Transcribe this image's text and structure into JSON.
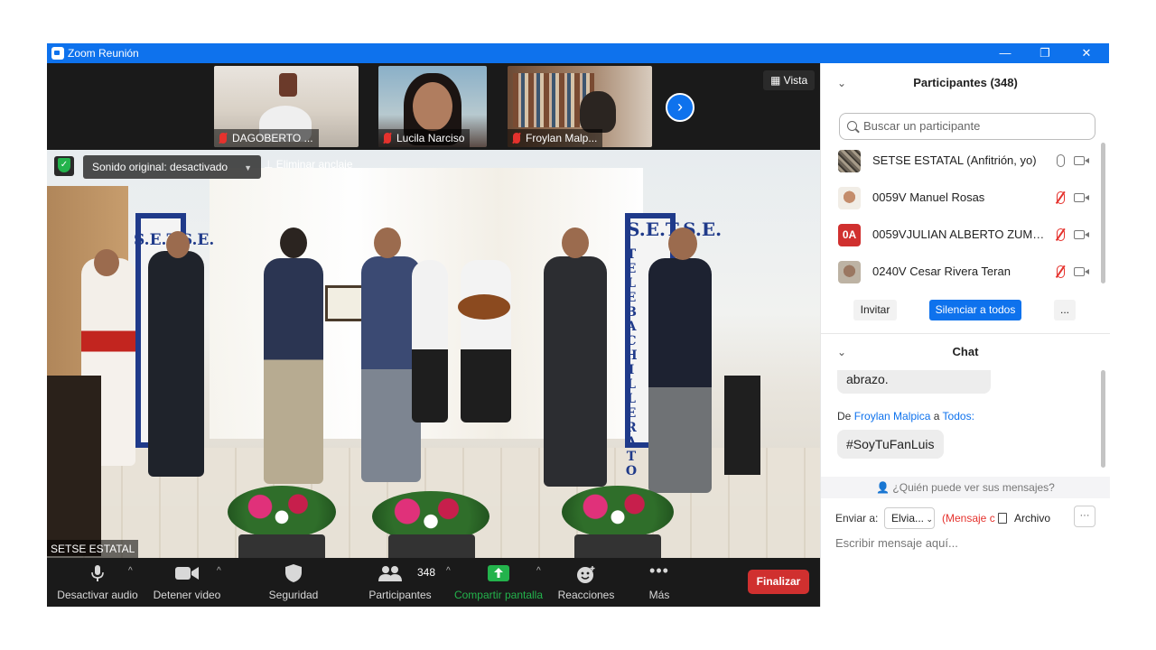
{
  "window": {
    "title": "Zoom Reunión",
    "controls": [
      "—",
      "❐",
      "✕"
    ]
  },
  "thumbnails": [
    {
      "name": "DAGOBERTO ..."
    },
    {
      "name": "Lucila Narciso"
    },
    {
      "name": "Froylan Malp..."
    }
  ],
  "view_label": "Vista",
  "main_video": {
    "sound_label": "Sonido original: desactivado",
    "unpin_label": "Eliminar anclaje",
    "self_name": "SETSE ESTATAL",
    "banner_left": "S.E.T.S.E.",
    "banner_right": "S.E.T.S.E.",
    "banner_vertical": "TELEBACHILLERATO"
  },
  "toolbar": {
    "mute": "Desactivar audio",
    "video": "Detener video",
    "security": "Seguridad",
    "participants": "Participantes",
    "participants_count": "348",
    "share": "Compartir pantalla",
    "reactions": "Reacciones",
    "more": "Más",
    "end": "Finalizar"
  },
  "participants_panel": {
    "title": "Participantes (348)",
    "search_placeholder": "Buscar un participante",
    "rows": [
      {
        "name": "SETSE ESTATAL (Anfitrión, yo)",
        "muted": false
      },
      {
        "name": "0059V Manuel Rosas",
        "muted": true
      },
      {
        "name": "0059VJULIAN ALBERTO ZUMAYA...",
        "muted": true,
        "initials": "0A"
      },
      {
        "name": "0240V Cesar Rivera Teran",
        "muted": true
      }
    ],
    "invite": "Invitar",
    "mute_all": "Silenciar a todos",
    "more": "..."
  },
  "chat": {
    "title": "Chat",
    "prev_message": "abrazo.",
    "from_prefix": "De",
    "from_name": "Froylan Malpica",
    "to_word": "a",
    "to_name": "Todos:",
    "message": "#SoyTuFanLuis",
    "who_sees": "¿Quién puede ver sus mensajes?",
    "send_to": "Enviar a:",
    "recipient": "Elvia...",
    "private_hint": "(Mensaje c",
    "file": "Archivo",
    "more": "···",
    "input_placeholder": "Escribir mensaje aquí..."
  },
  "colors": {
    "zoom_blue": "#0e72ed",
    "end_red": "#d0302f",
    "share_green": "#23b34c",
    "muted_red": "#e5322d"
  }
}
